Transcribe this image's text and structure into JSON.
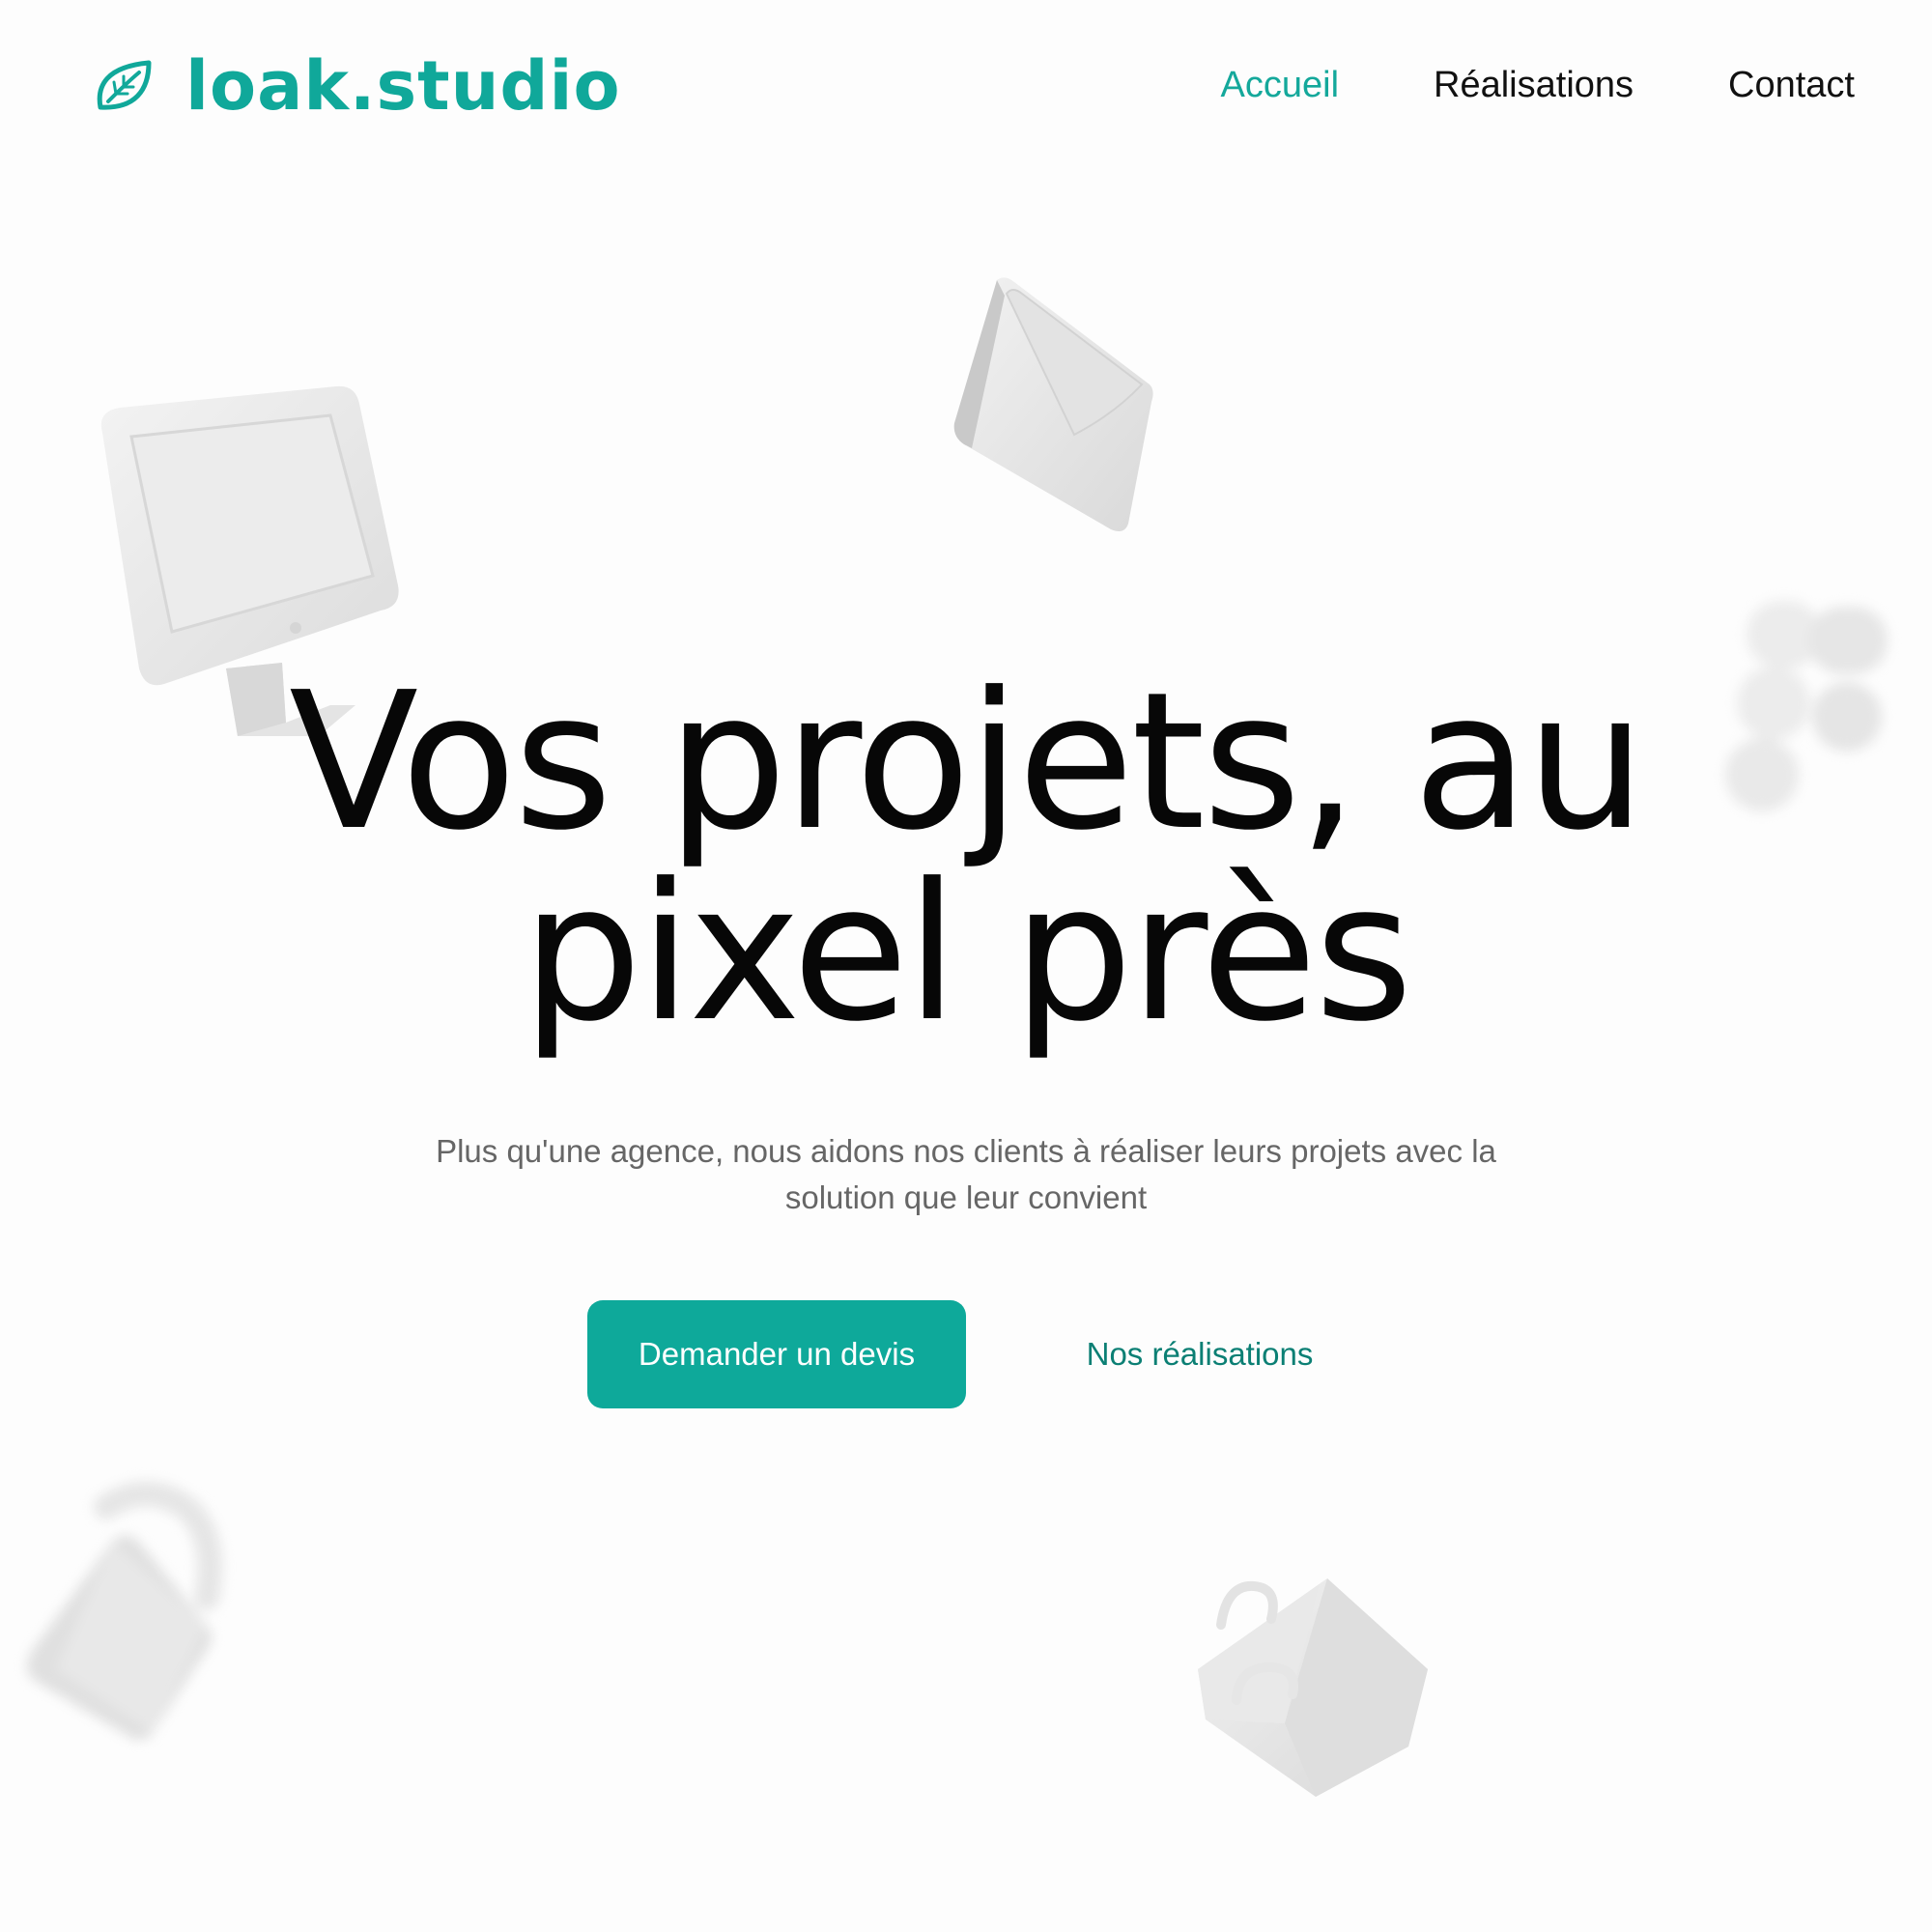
{
  "brand": {
    "name": "loak.studio",
    "color": "#10a89a"
  },
  "nav": {
    "items": [
      {
        "label": "Accueil",
        "active": true
      },
      {
        "label": "Réalisations",
        "active": false
      },
      {
        "label": "Contact",
        "active": false
      }
    ],
    "active_color": "#14a89b"
  },
  "hero": {
    "title_line1": "Vos projets, au",
    "title_line2": "pixel près",
    "subtitle": "Plus qu'une agence, nous aidons nos clients à réaliser leurs projets avec la solution que leur convient",
    "primary_cta": "Demander un devis",
    "secondary_cta": "Nos réalisations"
  },
  "decorations": {
    "icons": [
      "monitor-icon",
      "envelope-icon",
      "figma-logo-icon",
      "padlock-icon",
      "shopping-bag-icon"
    ]
  }
}
